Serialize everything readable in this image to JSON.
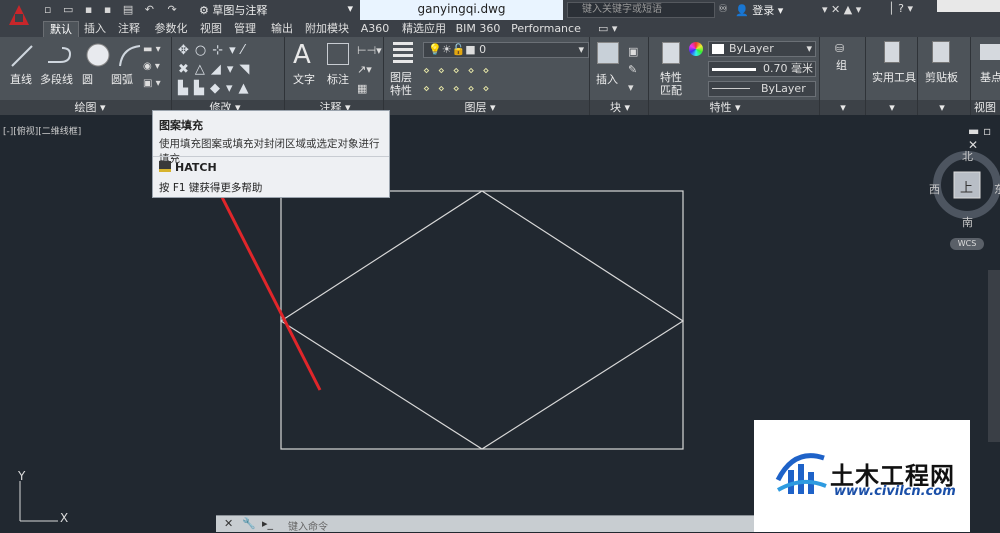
{
  "titlebar": {
    "workspace": "草图与注释",
    "file_tab": "ganyingqi.dwg",
    "search_placeholder": "键入关键字或短语",
    "login": "登录"
  },
  "tabs": [
    {
      "label": "默认",
      "active": true
    },
    {
      "label": "插入"
    },
    {
      "label": "注释"
    },
    {
      "label": "参数化"
    },
    {
      "label": "视图"
    },
    {
      "label": "管理"
    },
    {
      "label": "输出"
    },
    {
      "label": "附加模块"
    },
    {
      "label": "A360"
    },
    {
      "label": "精选应用"
    },
    {
      "label": "BIM 360"
    },
    {
      "label": "Performance"
    }
  ],
  "ribbon": {
    "draw": {
      "line": "直线",
      "polyline": "多段线",
      "circle": "圆",
      "arc": "圆弧",
      "title": "绘图 ▾"
    },
    "modify": {
      "title": "修改 ▾"
    },
    "annotation": {
      "text": "文字",
      "dimension": "标注",
      "title": "注释 ▾"
    },
    "layers": {
      "layer_props_1": "图层",
      "layer_props_2": "特性",
      "layer_value": "0",
      "title": "图层 ▾"
    },
    "block": {
      "insert": "插入",
      "title": "块 ▾"
    },
    "properties": {
      "match_1": "特性",
      "match_2": "匹配",
      "color": "ByLayer",
      "lineweight": "0.70 毫米",
      "linetype": "ByLayer",
      "title": "特性 ▾"
    },
    "groups": {
      "group": "组",
      "title": "▾"
    },
    "utilities": {
      "label": "实用工具",
      "title": "▾"
    },
    "clipboard": {
      "label": "剪贴板",
      "title": "▾"
    },
    "view": {
      "base": "基点",
      "title": "视图 ▾"
    }
  },
  "viewport": {
    "label": "[-][俯视][二维线框]",
    "compass": {
      "north": "北",
      "south": "南",
      "west": "西",
      "east": "东",
      "top": "上"
    },
    "wcs": "WCS",
    "ucs_x": "X",
    "ucs_y": "Y"
  },
  "tooltip": {
    "title": "图案填充",
    "description": "使用填充图案或填充对封闭区域或选定对象进行填充",
    "command": "HATCH",
    "help": "按 F1 键获得更多帮助"
  },
  "cmdline": {
    "placeholder": "键入命令"
  },
  "watermark": {
    "name": "土木工程网",
    "url": "www.civilcn.com"
  },
  "colors": {
    "background": "#212830",
    "ribbon": "#4d5359",
    "annotation_arrow": "#e0262a",
    "geometry": "#d8d8d8",
    "accent": "#c8262a"
  }
}
